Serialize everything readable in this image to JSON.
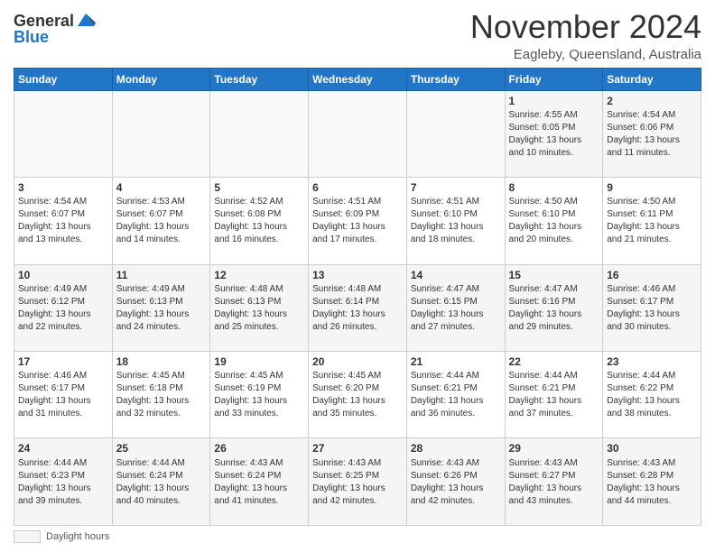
{
  "logo": {
    "general": "General",
    "blue": "Blue"
  },
  "header": {
    "month": "November 2024",
    "location": "Eagleby, Queensland, Australia"
  },
  "weekdays": [
    "Sunday",
    "Monday",
    "Tuesday",
    "Wednesday",
    "Thursday",
    "Friday",
    "Saturday"
  ],
  "legend": {
    "label": "Daylight hours"
  },
  "weeks": [
    [
      {
        "day": "",
        "info": ""
      },
      {
        "day": "",
        "info": ""
      },
      {
        "day": "",
        "info": ""
      },
      {
        "day": "",
        "info": ""
      },
      {
        "day": "",
        "info": ""
      },
      {
        "day": "1",
        "info": "Sunrise: 4:55 AM\nSunset: 6:05 PM\nDaylight: 13 hours and 10 minutes."
      },
      {
        "day": "2",
        "info": "Sunrise: 4:54 AM\nSunset: 6:06 PM\nDaylight: 13 hours and 11 minutes."
      }
    ],
    [
      {
        "day": "3",
        "info": "Sunrise: 4:54 AM\nSunset: 6:07 PM\nDaylight: 13 hours and 13 minutes."
      },
      {
        "day": "4",
        "info": "Sunrise: 4:53 AM\nSunset: 6:07 PM\nDaylight: 13 hours and 14 minutes."
      },
      {
        "day": "5",
        "info": "Sunrise: 4:52 AM\nSunset: 6:08 PM\nDaylight: 13 hours and 16 minutes."
      },
      {
        "day": "6",
        "info": "Sunrise: 4:51 AM\nSunset: 6:09 PM\nDaylight: 13 hours and 17 minutes."
      },
      {
        "day": "7",
        "info": "Sunrise: 4:51 AM\nSunset: 6:10 PM\nDaylight: 13 hours and 18 minutes."
      },
      {
        "day": "8",
        "info": "Sunrise: 4:50 AM\nSunset: 6:10 PM\nDaylight: 13 hours and 20 minutes."
      },
      {
        "day": "9",
        "info": "Sunrise: 4:50 AM\nSunset: 6:11 PM\nDaylight: 13 hours and 21 minutes."
      }
    ],
    [
      {
        "day": "10",
        "info": "Sunrise: 4:49 AM\nSunset: 6:12 PM\nDaylight: 13 hours and 22 minutes."
      },
      {
        "day": "11",
        "info": "Sunrise: 4:49 AM\nSunset: 6:13 PM\nDaylight: 13 hours and 24 minutes."
      },
      {
        "day": "12",
        "info": "Sunrise: 4:48 AM\nSunset: 6:13 PM\nDaylight: 13 hours and 25 minutes."
      },
      {
        "day": "13",
        "info": "Sunrise: 4:48 AM\nSunset: 6:14 PM\nDaylight: 13 hours and 26 minutes."
      },
      {
        "day": "14",
        "info": "Sunrise: 4:47 AM\nSunset: 6:15 PM\nDaylight: 13 hours and 27 minutes."
      },
      {
        "day": "15",
        "info": "Sunrise: 4:47 AM\nSunset: 6:16 PM\nDaylight: 13 hours and 29 minutes."
      },
      {
        "day": "16",
        "info": "Sunrise: 4:46 AM\nSunset: 6:17 PM\nDaylight: 13 hours and 30 minutes."
      }
    ],
    [
      {
        "day": "17",
        "info": "Sunrise: 4:46 AM\nSunset: 6:17 PM\nDaylight: 13 hours and 31 minutes."
      },
      {
        "day": "18",
        "info": "Sunrise: 4:45 AM\nSunset: 6:18 PM\nDaylight: 13 hours and 32 minutes."
      },
      {
        "day": "19",
        "info": "Sunrise: 4:45 AM\nSunset: 6:19 PM\nDaylight: 13 hours and 33 minutes."
      },
      {
        "day": "20",
        "info": "Sunrise: 4:45 AM\nSunset: 6:20 PM\nDaylight: 13 hours and 35 minutes."
      },
      {
        "day": "21",
        "info": "Sunrise: 4:44 AM\nSunset: 6:21 PM\nDaylight: 13 hours and 36 minutes."
      },
      {
        "day": "22",
        "info": "Sunrise: 4:44 AM\nSunset: 6:21 PM\nDaylight: 13 hours and 37 minutes."
      },
      {
        "day": "23",
        "info": "Sunrise: 4:44 AM\nSunset: 6:22 PM\nDaylight: 13 hours and 38 minutes."
      }
    ],
    [
      {
        "day": "24",
        "info": "Sunrise: 4:44 AM\nSunset: 6:23 PM\nDaylight: 13 hours and 39 minutes."
      },
      {
        "day": "25",
        "info": "Sunrise: 4:44 AM\nSunset: 6:24 PM\nDaylight: 13 hours and 40 minutes."
      },
      {
        "day": "26",
        "info": "Sunrise: 4:43 AM\nSunset: 6:24 PM\nDaylight: 13 hours and 41 minutes."
      },
      {
        "day": "27",
        "info": "Sunrise: 4:43 AM\nSunset: 6:25 PM\nDaylight: 13 hours and 42 minutes."
      },
      {
        "day": "28",
        "info": "Sunrise: 4:43 AM\nSunset: 6:26 PM\nDaylight: 13 hours and 42 minutes."
      },
      {
        "day": "29",
        "info": "Sunrise: 4:43 AM\nSunset: 6:27 PM\nDaylight: 13 hours and 43 minutes."
      },
      {
        "day": "30",
        "info": "Sunrise: 4:43 AM\nSunset: 6:28 PM\nDaylight: 13 hours and 44 minutes."
      }
    ]
  ]
}
